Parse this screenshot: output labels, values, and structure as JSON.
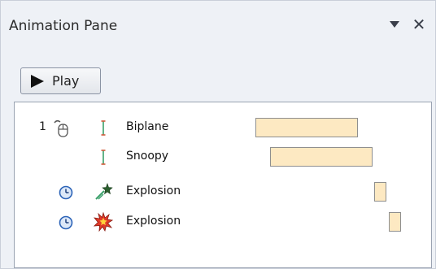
{
  "pane": {
    "title": "Animation Pane",
    "dropdown_icon": "triangle-down-icon",
    "close_icon": "close-icon",
    "close_glyph": "✕"
  },
  "play_button": {
    "label": "Play",
    "icon": "play-icon"
  },
  "animations": [
    {
      "order": "1",
      "start": "on-click",
      "effect": "entrance-line-icon",
      "name": "Biplane",
      "timing": {
        "start": 0.0,
        "duration": 1.0
      }
    },
    {
      "order": "",
      "start": "with-previous",
      "effect": "entrance-line-icon",
      "name": "Snoopy",
      "timing": {
        "start": 0.14,
        "duration": 1.0
      }
    },
    {
      "order": "",
      "start": "after-previous",
      "effect": "star-burst-green-icon",
      "name": "Explosion",
      "timing": {
        "start": 1.16,
        "duration": 0.12
      }
    },
    {
      "order": "",
      "start": "after-previous",
      "effect": "explosion-red-icon",
      "name": "Explosion",
      "timing": {
        "start": 1.3,
        "duration": 0.12
      }
    }
  ],
  "colors": {
    "bar_fill": "#fde9c2",
    "bar_border": "#8f8f8f",
    "pane_background": "#eef1f6",
    "list_background": "#ffffff"
  }
}
